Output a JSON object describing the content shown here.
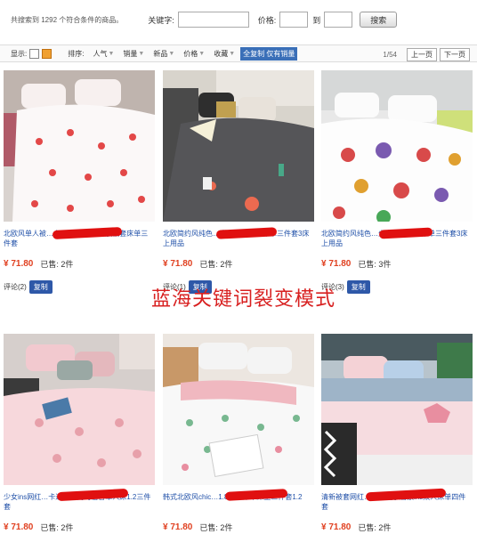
{
  "search": {
    "found_text": "共搜索到 1292 个符合条件的商品。",
    "keyword_label": "关键字:",
    "keyword_value": "",
    "price_label": "价格:",
    "price_to": "到",
    "search_button": "搜索"
  },
  "toolbar": {
    "display_label": "显示:",
    "sort_label": "排序:",
    "sorts": [
      "人气",
      "销量",
      "新品",
      "价格",
      "收藏"
    ],
    "copy_all": "全复制",
    "copy_sales": "仅有销量",
    "page": "1/54",
    "prev": "上一页",
    "next": "下一页"
  },
  "products": [
    {
      "title": "北欧风单人被…上用品ins网红亲肤被套床单三件套",
      "price": "¥ 71.80",
      "sold": "已售: 2件",
      "reviews": "评论(2)",
      "copy": "复制"
    },
    {
      "title": "北欧简约风纯色…少女粉色被套床单三件套3床上用品",
      "price": "¥ 71.80",
      "sold": "已售: 2件",
      "reviews": "评论(1)",
      "copy": "复制"
    },
    {
      "title": "北欧简约风纯色…少女粉色被套床单三件套3床上用品",
      "price": "¥ 71.80",
      "sold": "已售: 3件",
      "reviews": "评论(3)",
      "copy": "复制"
    },
    {
      "title": "少女ins网红…卡通被套简约宿舍单人床1.2三件套",
      "price": "¥ 71.80",
      "sold": "已售: 2件",
      "reviews": "",
      "copy": ""
    },
    {
      "title": "韩式北欧风chic…1.8单人床单床上三件套1.2",
      "price": "¥ 71.80",
      "sold": "已售: 2件",
      "reviews": "",
      "copy": ""
    },
    {
      "title": "清新被套网红…田园夏季居家ins双人床单四件套",
      "price": "¥ 71.80",
      "sold": "已售: 2件",
      "reviews": "",
      "copy": ""
    }
  ],
  "watermark": "蓝海关键词裂变模式",
  "colors": {
    "link": "#2050a8",
    "price": "#e04020",
    "button_blue": "#2e58a8",
    "watermark": "#d82020"
  }
}
